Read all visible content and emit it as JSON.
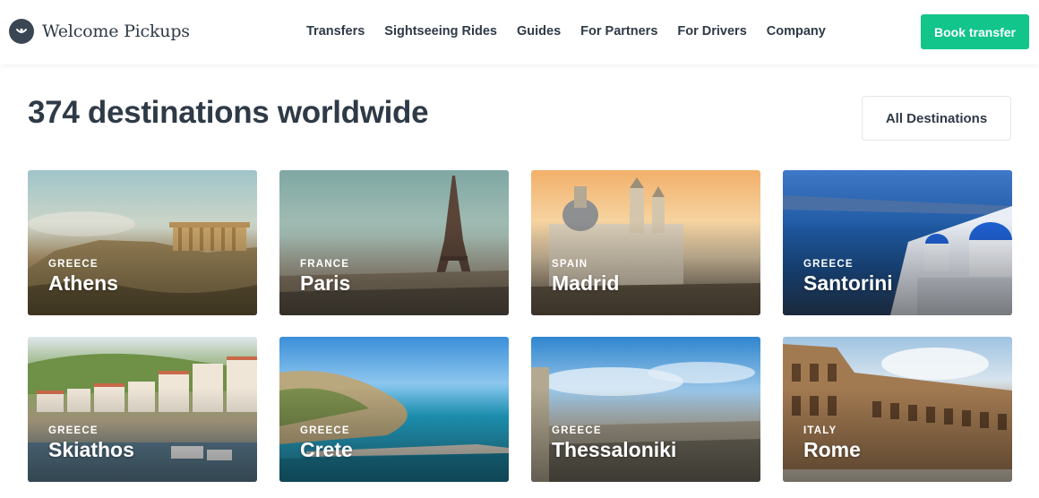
{
  "header": {
    "logo_text": "Welcome Pickups",
    "nav": [
      "Transfers",
      "Sightseeing Rides",
      "Guides",
      "For Partners",
      "For Drivers",
      "Company"
    ],
    "book_label": "Book transfer",
    "accent": "#12c58a"
  },
  "main": {
    "title": "374 destinations worldwide",
    "all_destinations_label": "All Destinations",
    "destinations": [
      {
        "country": "GREECE",
        "city": "Athens"
      },
      {
        "country": "FRANCE",
        "city": "Paris"
      },
      {
        "country": "SPAIN",
        "city": "Madrid"
      },
      {
        "country": "GREECE",
        "city": "Santorini"
      },
      {
        "country": "GREECE",
        "city": "Skiathos"
      },
      {
        "country": "GREECE",
        "city": "Crete"
      },
      {
        "country": "GREECE",
        "city": "Thessaloniki"
      },
      {
        "country": "ITALY",
        "city": "Rome"
      }
    ]
  }
}
